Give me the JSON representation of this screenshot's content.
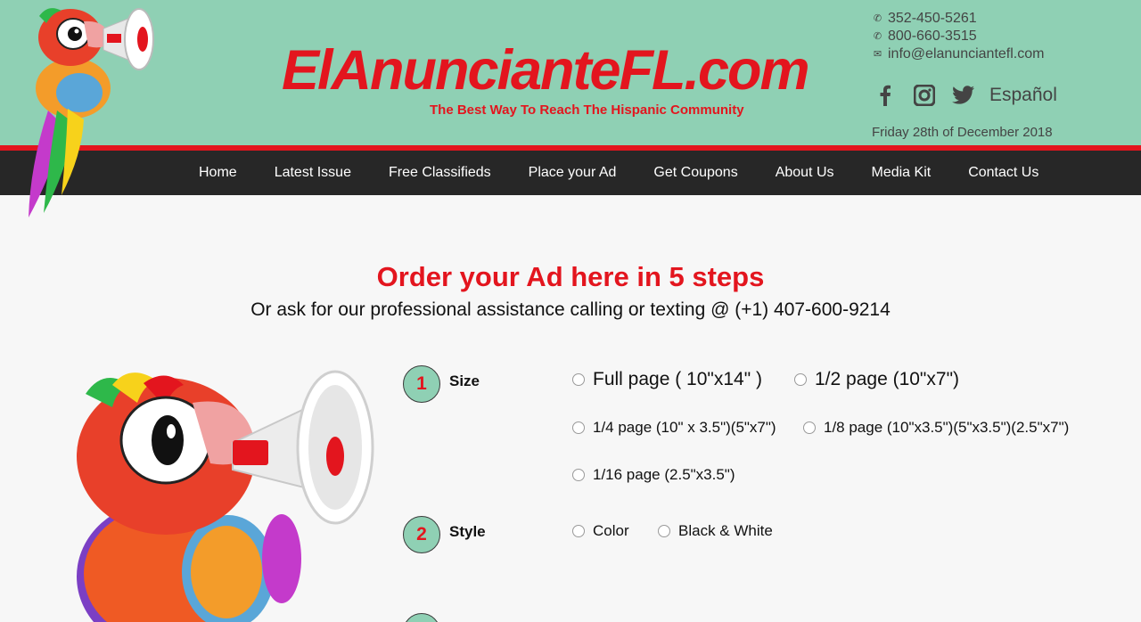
{
  "header": {
    "logo": "ElAnuncianteFL.com",
    "tagline": "The Best Way To Reach The Hispanic Community",
    "phone1": "352-450-5261",
    "phone2": "800-660-3515",
    "email": "info@elanunciantefl.com",
    "language": "Español",
    "date": "Friday 28th of December 2018"
  },
  "icons": {
    "phone": "phone-icon",
    "email": "envelope-icon",
    "facebook": "facebook-icon",
    "instagram": "instagram-icon",
    "twitter": "twitter-icon"
  },
  "nav": {
    "items": [
      "Home",
      "Latest Issue",
      "Free Classifieds",
      "Place your Ad",
      "Get Coupons",
      "About Us",
      "Media Kit",
      "Contact Us"
    ]
  },
  "main": {
    "title": "Order your Ad here in 5 steps",
    "subtitle": "Or ask for our professional assistance calling or texting @ (+1) 407-600-9214",
    "steps": [
      {
        "number": "1",
        "label": "Size",
        "options": [
          "Full page ( 10\"x14\" )",
          "1/2 page (10\"x7\")",
          "1/4 page (10\" x 3.5\")(5\"x7\")",
          "1/8 page (10\"x3.5\")(5\"x3.5\")(2.5\"x7\")",
          "1/16 page (2.5\"x3.5\")"
        ]
      },
      {
        "number": "2",
        "label": "Style",
        "options": [
          "Color",
          "Black & White"
        ]
      }
    ]
  },
  "colors": {
    "header_bg": "#8fd0b4",
    "accent_red": "#e3151e",
    "nav_bg": "#272727",
    "page_bg": "#f7f7f7"
  }
}
